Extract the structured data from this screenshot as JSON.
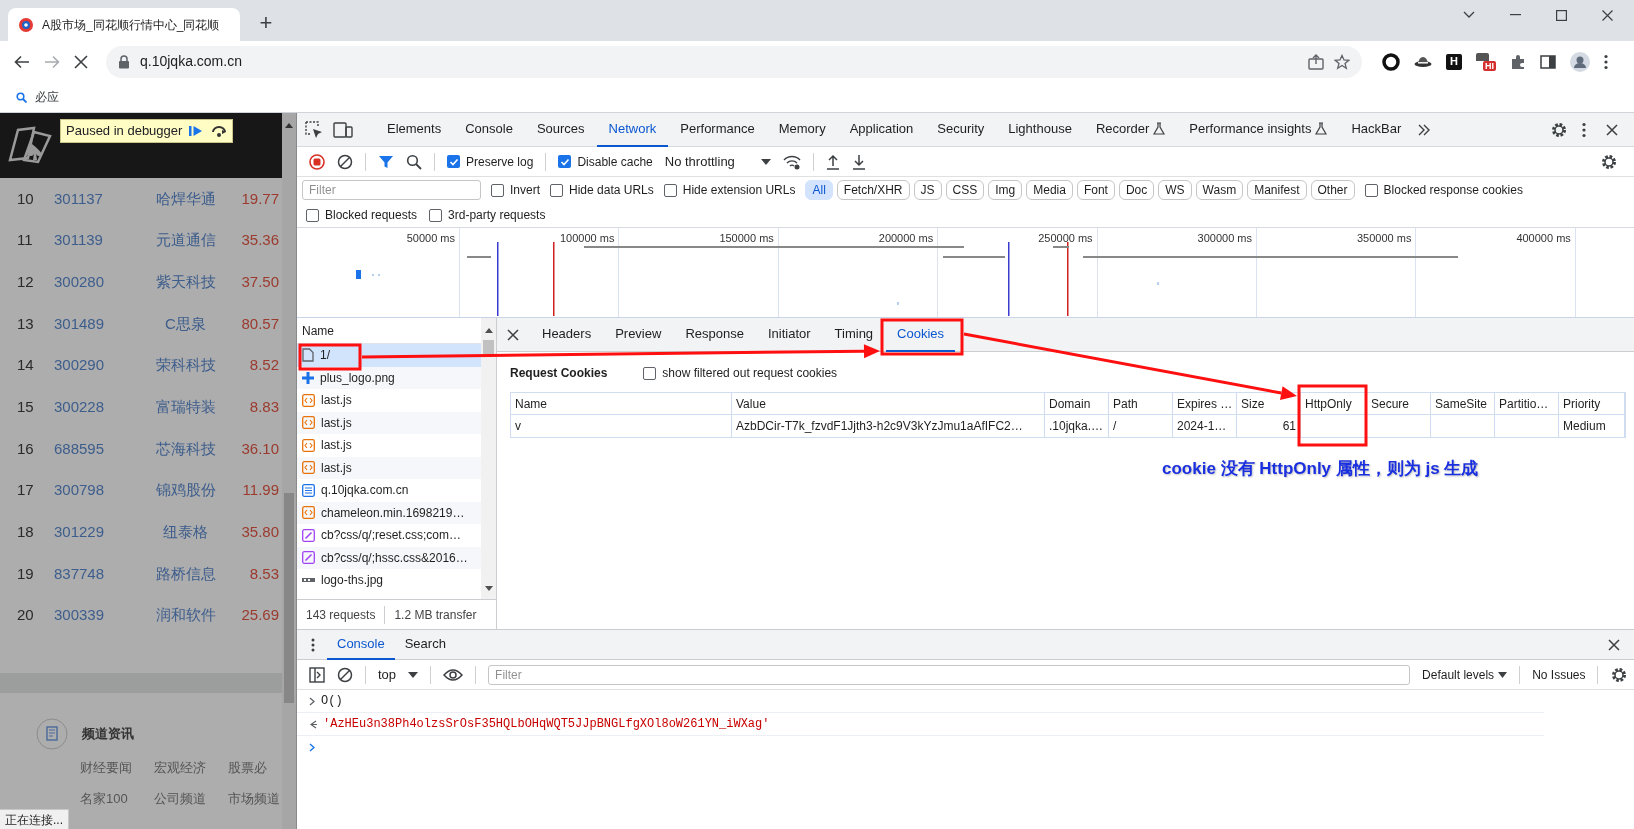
{
  "browser": {
    "tab": {
      "title": "A股市场_同花顺行情中心_同花顺"
    },
    "new_tab": "+",
    "url": "q.10jqka.com.cn",
    "extension_letter": "H",
    "extension_badge": "HI",
    "bookmarks": [
      {
        "label": "必应"
      }
    ]
  },
  "page": {
    "banner": "Paused in debugger",
    "rows": [
      {
        "rank": "10",
        "code": "301137",
        "name": "哈焊华通",
        "price": "19.77"
      },
      {
        "rank": "11",
        "code": "301139",
        "name": "元道通信",
        "price": "35.36"
      },
      {
        "rank": "12",
        "code": "300280",
        "name": "紫天科技",
        "price": "37.50"
      },
      {
        "rank": "13",
        "code": "301489",
        "name": "C思泉",
        "price": "80.57"
      },
      {
        "rank": "14",
        "code": "300290",
        "name": "荣科科技",
        "price": "8.52"
      },
      {
        "rank": "15",
        "code": "300228",
        "name": "富瑞特装",
        "price": "8.83"
      },
      {
        "rank": "16",
        "code": "688595",
        "name": "芯海科技",
        "price": "36.10"
      },
      {
        "rank": "17",
        "code": "300798",
        "name": "锦鸡股份",
        "price": "11.99"
      },
      {
        "rank": "18",
        "code": "301229",
        "name": "纽泰格",
        "price": "35.80"
      },
      {
        "rank": "19",
        "code": "837748",
        "name": "路桥信息",
        "price": "8.53"
      },
      {
        "rank": "20",
        "code": "300339",
        "name": "润和软件",
        "price": "25.69"
      }
    ],
    "section_title": "频道资讯",
    "links": [
      [
        "财经要闻",
        "宏观经济",
        "股票必"
      ],
      [
        "名家100",
        "公司频道",
        "市场频道"
      ]
    ]
  },
  "status_text": "正在连接...",
  "devtools": {
    "tabs": [
      {
        "label": "Elements",
        "selected": false,
        "experimental": false
      },
      {
        "label": "Console",
        "selected": false,
        "experimental": false
      },
      {
        "label": "Sources",
        "selected": false,
        "experimental": false
      },
      {
        "label": "Network",
        "selected": true,
        "experimental": false
      },
      {
        "label": "Performance",
        "selected": false,
        "experimental": false
      },
      {
        "label": "Memory",
        "selected": false,
        "experimental": false
      },
      {
        "label": "Application",
        "selected": false,
        "experimental": false
      },
      {
        "label": "Security",
        "selected": false,
        "experimental": false
      },
      {
        "label": "Lighthouse",
        "selected": false,
        "experimental": false
      },
      {
        "label": "Recorder",
        "selected": false,
        "experimental": true
      },
      {
        "label": "Performance insights",
        "selected": false,
        "experimental": true
      },
      {
        "label": "HackBar",
        "selected": false,
        "experimental": false
      }
    ],
    "network_toolbar": {
      "preserve_log": {
        "label": "Preserve log",
        "checked": true
      },
      "disable_cache": {
        "label": "Disable cache",
        "checked": true
      },
      "throttling": "No throttling"
    },
    "filter_bar": {
      "placeholder": "Filter",
      "options": [
        {
          "label": "Invert",
          "checked": false
        },
        {
          "label": "Hide data URLs",
          "checked": false
        },
        {
          "label": "Hide extension URLs",
          "checked": false
        }
      ],
      "types": [
        {
          "label": "All",
          "selected": true
        },
        {
          "label": "Fetch/XHR",
          "selected": false
        },
        {
          "label": "JS",
          "selected": false
        },
        {
          "label": "CSS",
          "selected": false
        },
        {
          "label": "Img",
          "selected": false
        },
        {
          "label": "Media",
          "selected": false
        },
        {
          "label": "Font",
          "selected": false
        },
        {
          "label": "Doc",
          "selected": false
        },
        {
          "label": "WS",
          "selected": false
        },
        {
          "label": "Wasm",
          "selected": false
        },
        {
          "label": "Manifest",
          "selected": false
        },
        {
          "label": "Other",
          "selected": false
        }
      ],
      "trailing_options": [
        {
          "label": "Blocked response cookies",
          "checked": false
        }
      ],
      "second_row_options": [
        {
          "label": "Blocked requests",
          "checked": false
        },
        {
          "label": "3rd-party requests",
          "checked": false
        }
      ]
    },
    "timeline": {
      "ticks": [
        "50000 ms",
        "100000 ms",
        "150000 ms",
        "200000 ms",
        "250000 ms",
        "300000 ms",
        "350000 ms",
        "400000 ms"
      ]
    },
    "requests": {
      "header": "Name",
      "items": [
        {
          "name": "1/",
          "kind": "page",
          "selected": true
        },
        {
          "name": "plus_logo.png",
          "kind": "plus",
          "selected": false
        },
        {
          "name": "last.js",
          "kind": "script",
          "selected": false
        },
        {
          "name": "last.js",
          "kind": "script",
          "selected": false
        },
        {
          "name": "last.js",
          "kind": "script",
          "selected": false
        },
        {
          "name": "last.js",
          "kind": "script",
          "selected": false
        },
        {
          "name": "q.10jqka.com.cn",
          "kind": "doc",
          "selected": false
        },
        {
          "name": "chameleon.min.1698219…",
          "kind": "script",
          "selected": false
        },
        {
          "name": "cb?css/q/;reset.css;com…",
          "kind": "css",
          "selected": false
        },
        {
          "name": "cb?css/q/;hssc.css&2016…",
          "kind": "css",
          "selected": false
        },
        {
          "name": "logo-ths.jpg",
          "kind": "image",
          "selected": false
        }
      ],
      "summary": [
        "143 requests",
        "1.2 MB transfer"
      ]
    },
    "details": {
      "tabs": [
        {
          "label": "Headers",
          "selected": false
        },
        {
          "label": "Preview",
          "selected": false
        },
        {
          "label": "Response",
          "selected": false
        },
        {
          "label": "Initiator",
          "selected": false
        },
        {
          "label": "Timing",
          "selected": false
        },
        {
          "label": "Cookies",
          "selected": true
        }
      ],
      "cookies": {
        "title": "Request Cookies",
        "show_filtered": {
          "label": "show filtered out request cookies",
          "checked": false
        },
        "columns": [
          "Name",
          "Value",
          "Domain",
          "Path",
          "Expires …",
          "Size",
          "HttpOnly",
          "Secure",
          "SameSite",
          "Partitio…",
          "Priority"
        ],
        "rows": [
          {
            "name": "v",
            "value": "AzbDCir-T7k_fzvdF1Jjth3-h2c9V3kYzJmu1aAfIFC2…",
            "domain": ".10jqka.…",
            "path": "/",
            "expires": "2024-1…",
            "size": "61",
            "priority": "Medium"
          }
        ]
      }
    },
    "annotation": "cookie 没有 HttpOnly 属性，则为 js 生成",
    "console": {
      "tabs": [
        {
          "label": "Console",
          "selected": true
        },
        {
          "label": "Search",
          "selected": false
        }
      ],
      "context": "top",
      "placeholder": "Filter",
      "levels": "Default levels",
      "issues": "No Issues",
      "lines": [
        {
          "kind": "input",
          "text": "O()"
        },
        {
          "kind": "output",
          "text": "'AzHEu3n38Ph4olzsSrOsF35HQLbOHqWQT5JJpBNGLfgXOl8oW261YN_iWXag'"
        }
      ]
    }
  }
}
